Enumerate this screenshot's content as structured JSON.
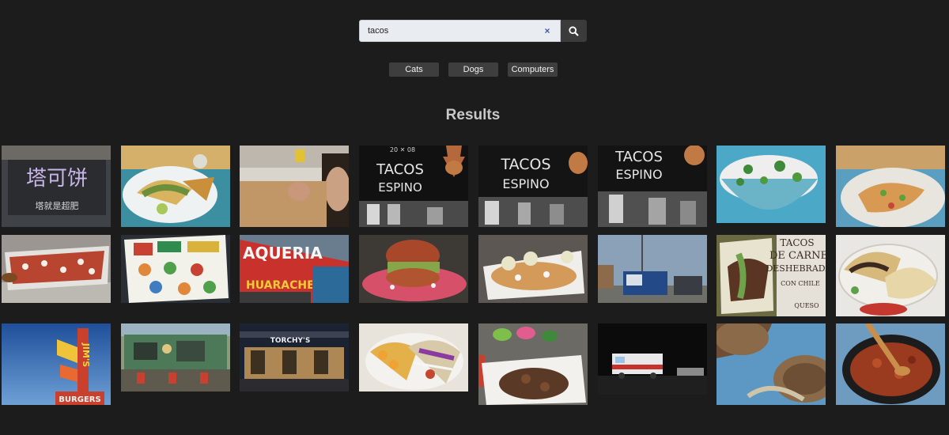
{
  "search": {
    "query": "tacos",
    "clear_label": "×"
  },
  "categories": [
    "Cats",
    "Dogs",
    "Computers"
  ],
  "results": {
    "title": "Results",
    "images": [
      {
        "name": "taco-shop-sign",
        "sign_text": "塔可饼",
        "sub_text": "塔就是超肥"
      },
      {
        "name": "taco-plate"
      },
      {
        "name": "person-holding-bag"
      },
      {
        "name": "tacos-espino-sign-1",
        "sign_top": "20 ✕ 08",
        "sign_main": "TACOS",
        "sign_sub": "ESPINO"
      },
      {
        "name": "tacos-espino-sign-2",
        "sign_main": "TACOS",
        "sign_sub": "ESPINO"
      },
      {
        "name": "tacos-espino-sign-3",
        "sign_main": "TACOS",
        "sign_sub": "ESPINO"
      },
      {
        "name": "rice-broccoli-bowl"
      },
      {
        "name": "pasta-dish"
      },
      {
        "name": "tlayuda-plate"
      },
      {
        "name": "menu-board"
      },
      {
        "name": "taqueria-mural",
        "sign_main": "AQUERIA",
        "sign_sub": "HUARACHES"
      },
      {
        "name": "torta-sandwich"
      },
      {
        "name": "tostada-plate"
      },
      {
        "name": "food-truck-lot"
      },
      {
        "name": "tacos-de-carne-poster",
        "line1": "TACOS",
        "line2": "DE CARNE",
        "line3": "DESHEBRADA",
        "line4": "CON CHILE",
        "line5": "QUESO"
      },
      {
        "name": "tacos-tortilla-plate"
      },
      {
        "name": "jims-burgers-sign",
        "sign_main": "JIM'S",
        "sign_sub": "BURGERS"
      },
      {
        "name": "green-storefront"
      },
      {
        "name": "torchys-storefront",
        "sign_main": "TORCHY'S"
      },
      {
        "name": "fish-tacos"
      },
      {
        "name": "taco-spread-table"
      },
      {
        "name": "food-truck-night"
      },
      {
        "name": "wooden-bowl"
      },
      {
        "name": "chili-skillet"
      }
    ]
  },
  "colors": {
    "background": "#1c1c1c",
    "button": "#3e3e3e",
    "accent": "#3a5ea8"
  }
}
